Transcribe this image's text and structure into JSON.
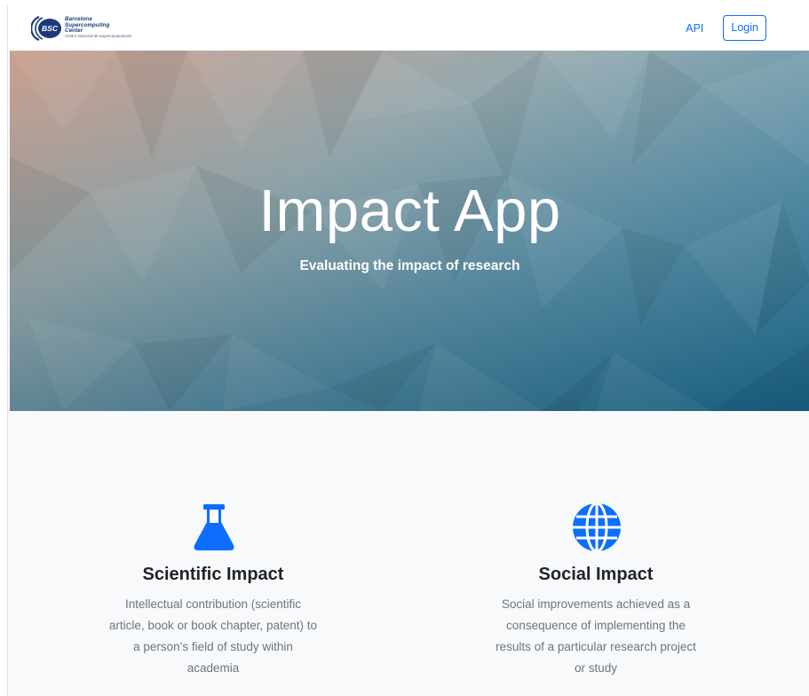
{
  "navbar": {
    "logo": {
      "mark": "BSC",
      "line1": "Barcelona",
      "line2": "Supercomputing",
      "line3": "Center",
      "subline": "Centro Nacional de Supercomputación"
    },
    "api_label": "API",
    "login_label": "Login"
  },
  "hero": {
    "title": "Impact App",
    "subtitle": "Evaluating the impact of research"
  },
  "features": [
    {
      "icon": "flask-icon",
      "title": "Scientific Impact",
      "description": "Intellectual contribution (scientific article, book or book chapter, patent) to a person’s field of study within academia"
    },
    {
      "icon": "globe-icon",
      "title": "Social Impact",
      "description": "Social improvements achieved as a consequence of implementing the results of a particular research project or study"
    }
  ],
  "colors": {
    "accent": "#0d6efd",
    "hero_start": "#c09a8a",
    "hero_end": "#1c6f93",
    "background": "#f8f9fa"
  }
}
